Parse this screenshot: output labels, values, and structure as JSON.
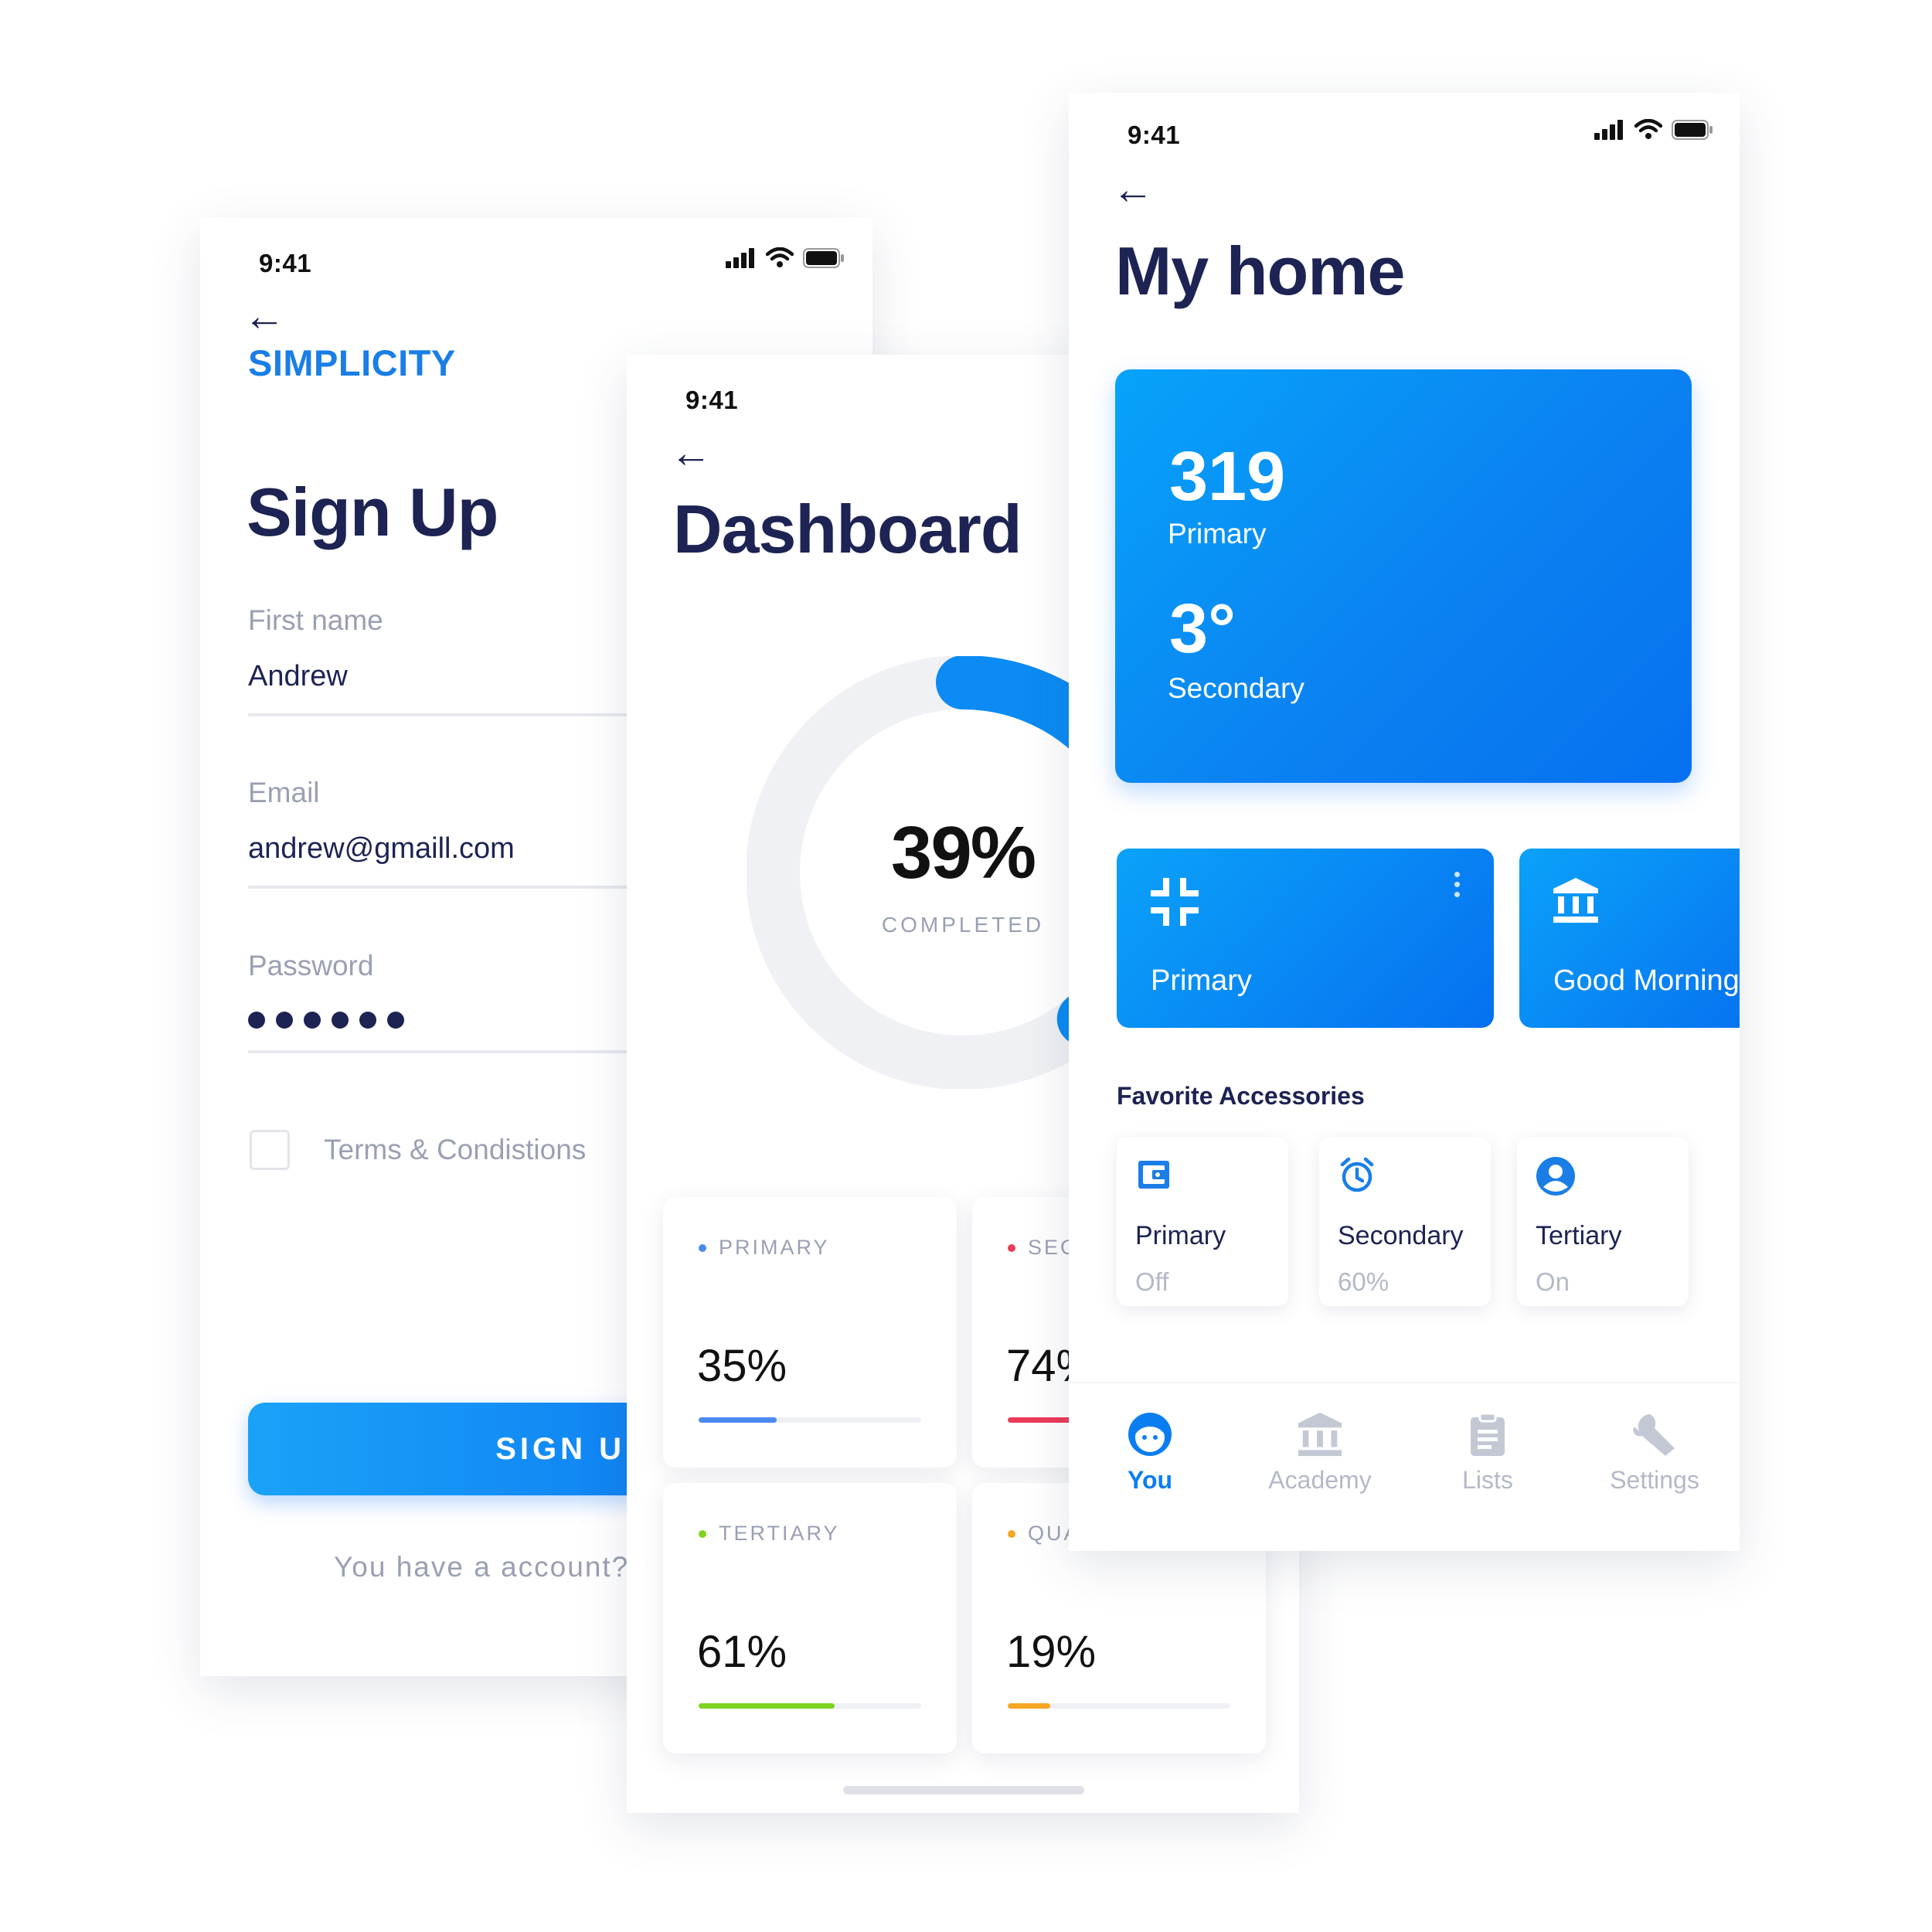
{
  "colors": {
    "accent": "#0a7ef0",
    "navy": "#1d2353",
    "muted": "#9aa0b3",
    "primary": "#4a8af0",
    "secondary": "#ec3a5a",
    "tertiary": "#7ed321",
    "quaternary": "#f5a623"
  },
  "status_bar": {
    "time": "9:41"
  },
  "signup": {
    "brand": "SIMPLICITY",
    "title": "Sign Up",
    "fields": [
      {
        "label": "First name",
        "value": "Andrew"
      },
      {
        "label": "Email",
        "value": "andrew@gmaill.com"
      },
      {
        "label": "Password",
        "value": ""
      }
    ],
    "terms_label": "Terms & Condistions",
    "terms_checked": false,
    "button_label": "SIGN UP",
    "footer_text": "You have a account?"
  },
  "dashboard": {
    "title": "Dashboard",
    "progress": {
      "percent": 39,
      "value_label": "39%",
      "caption": "COMPLETED"
    },
    "cards": [
      {
        "title": "PRIMARY",
        "value": "35%",
        "percent": 35
      },
      {
        "title": "SECONDARY",
        "value": "74%",
        "percent": 74
      },
      {
        "title": "TERTIARY",
        "value": "61%",
        "percent": 61
      },
      {
        "title": "QUATERNARY",
        "value": "19%",
        "percent": 19
      }
    ]
  },
  "home": {
    "title": "My home",
    "summary": {
      "value1": "319",
      "label1": "Primary",
      "value2": "3°",
      "label2": "Secondary"
    },
    "tiles": [
      {
        "label": "Primary",
        "icon": "collapse-icon"
      },
      {
        "label": "Good Morning",
        "icon": "bank-icon"
      }
    ],
    "favorites_title": "Favorite Accessories",
    "accessories": [
      {
        "name": "Primary",
        "state": "Off",
        "icon": "wallet-icon"
      },
      {
        "name": "Secondary",
        "state": "60%",
        "icon": "alarm-icon"
      },
      {
        "name": "Tertiary",
        "state": "On",
        "icon": "user-circle-icon"
      }
    ],
    "tabs": [
      {
        "label": "You",
        "icon": "face-icon",
        "active": true
      },
      {
        "label": "Academy",
        "icon": "bank-icon",
        "active": false
      },
      {
        "label": "Lists",
        "icon": "clipboard-icon",
        "active": false
      },
      {
        "label": "Settings",
        "icon": "wrench-icon",
        "active": false
      }
    ]
  }
}
